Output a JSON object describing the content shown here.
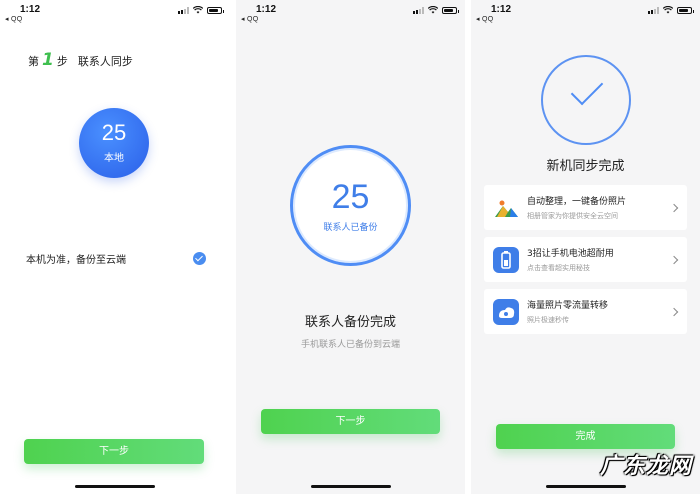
{
  "screens": [
    {
      "status": {
        "time": "1:12",
        "back_app": "◂ QQ"
      },
      "step": {
        "prefix": "第",
        "number": "1",
        "suffix": "步",
        "name": "联系人同步"
      },
      "local": {
        "count": "25",
        "label": "本地"
      },
      "option": {
        "label": "本机为准，备份至云端",
        "checked": true
      },
      "button": {
        "label": "下一步"
      }
    },
    {
      "status": {
        "time": "1:12",
        "back_app": "◂ QQ"
      },
      "ring": {
        "count": "25",
        "label": "联系人已备份"
      },
      "title": "联系人备份完成",
      "subtitle": "手机联系人已备份到云端",
      "button": {
        "label": "下一步"
      }
    },
    {
      "status": {
        "time": "1:12",
        "back_app": "◂ QQ"
      },
      "title": "新机同步完成",
      "cards": [
        {
          "title": "自动整理，一键备份照片",
          "subtitle": "相册管家为你提供安全云空间",
          "icon": "mountain-photo-icon"
        },
        {
          "title": "3招让手机电池超耐用",
          "subtitle": "点击查看超实用秘技",
          "icon": "battery-icon"
        },
        {
          "title": "海量照片零流量转移",
          "subtitle": "照片极速秒传",
          "icon": "cloud-transfer-icon"
        }
      ],
      "button": {
        "label": "完成"
      }
    }
  ],
  "watermark": "广东龙网",
  "colors": {
    "accent_green": "#4fd24f",
    "accent_blue": "#3f7ee8",
    "step_number": "#3fbf4f"
  }
}
